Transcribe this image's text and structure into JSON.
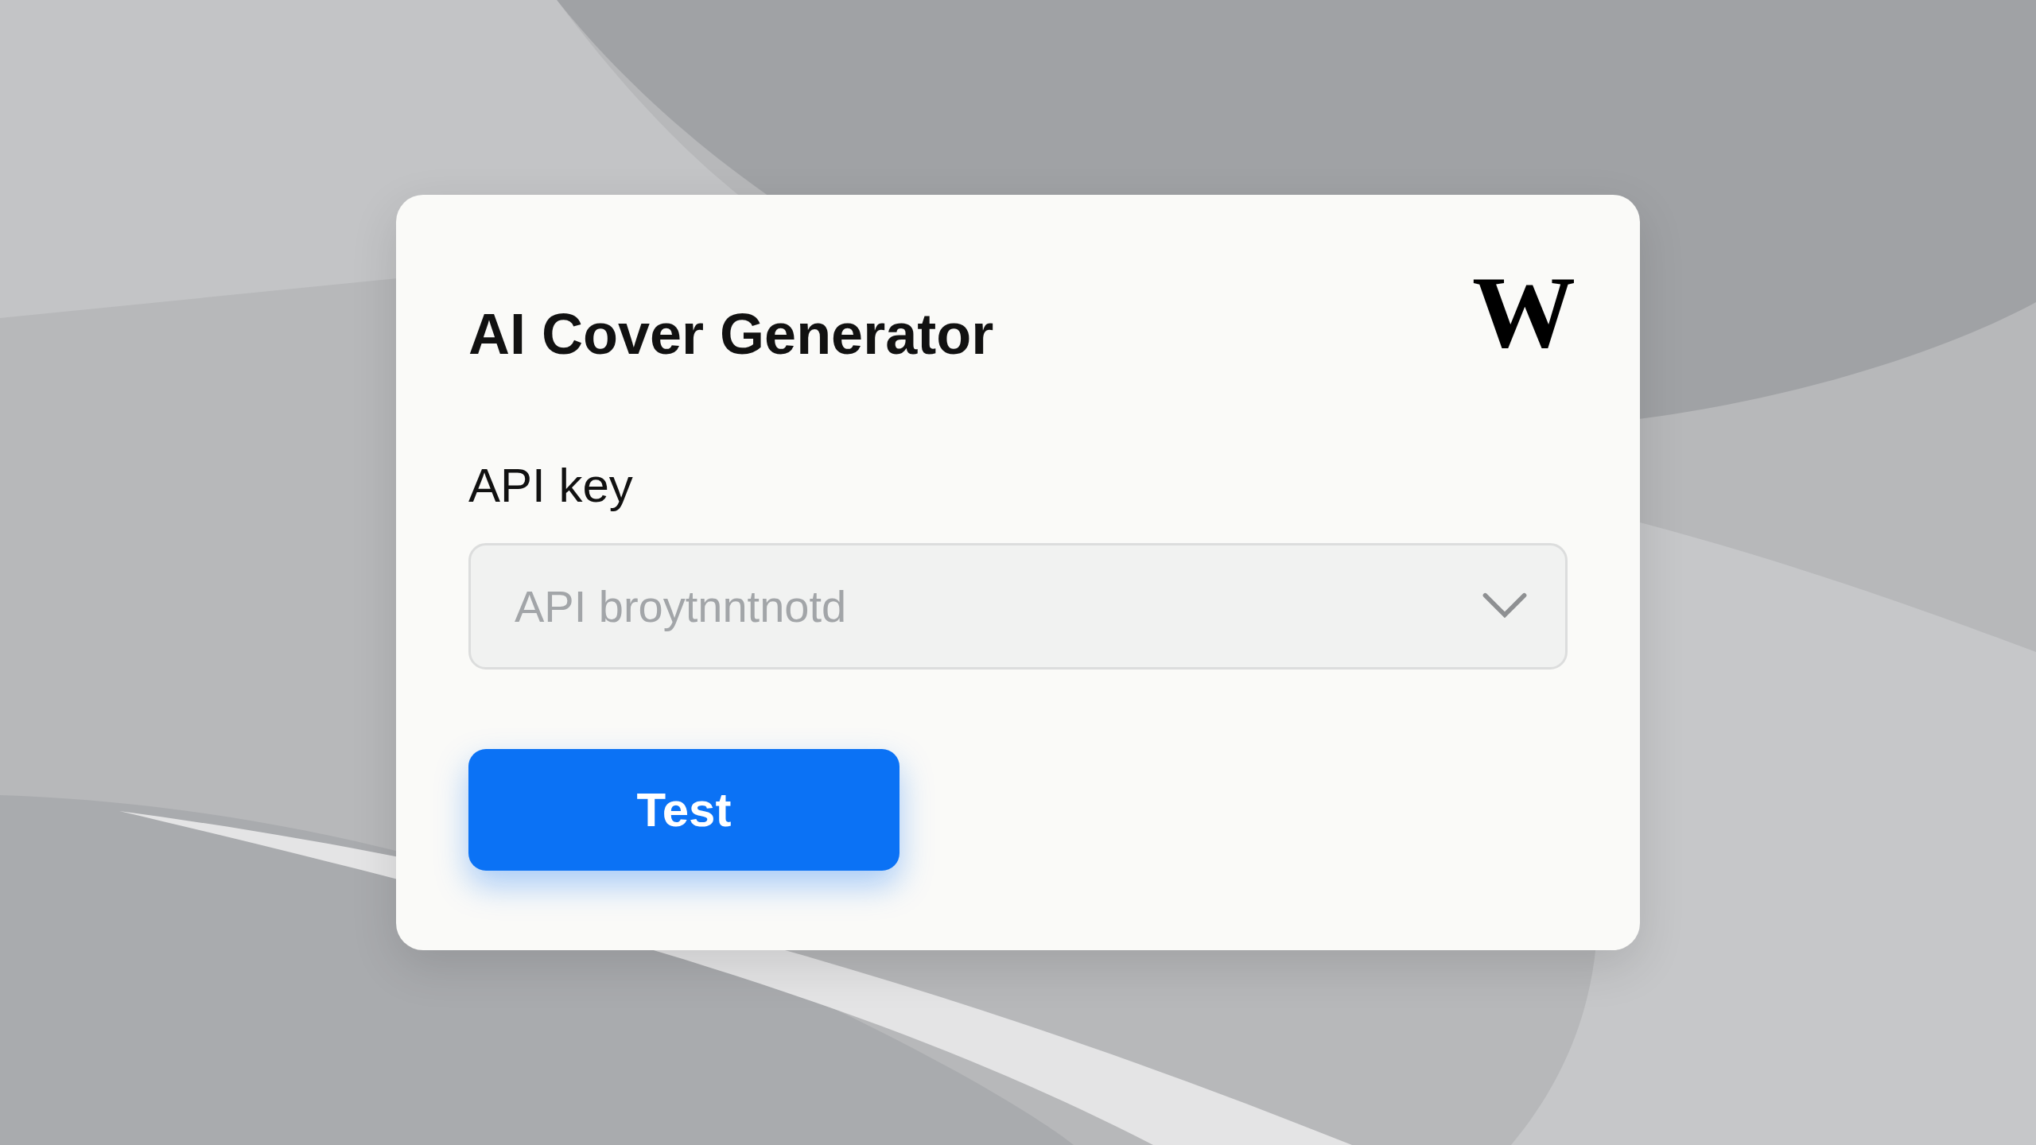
{
  "dialog": {
    "title": "AI Cover Generator",
    "logo": "W"
  },
  "field": {
    "label": "API key",
    "placeholder": "API broytnntnotd"
  },
  "button": {
    "label": "Test"
  }
}
